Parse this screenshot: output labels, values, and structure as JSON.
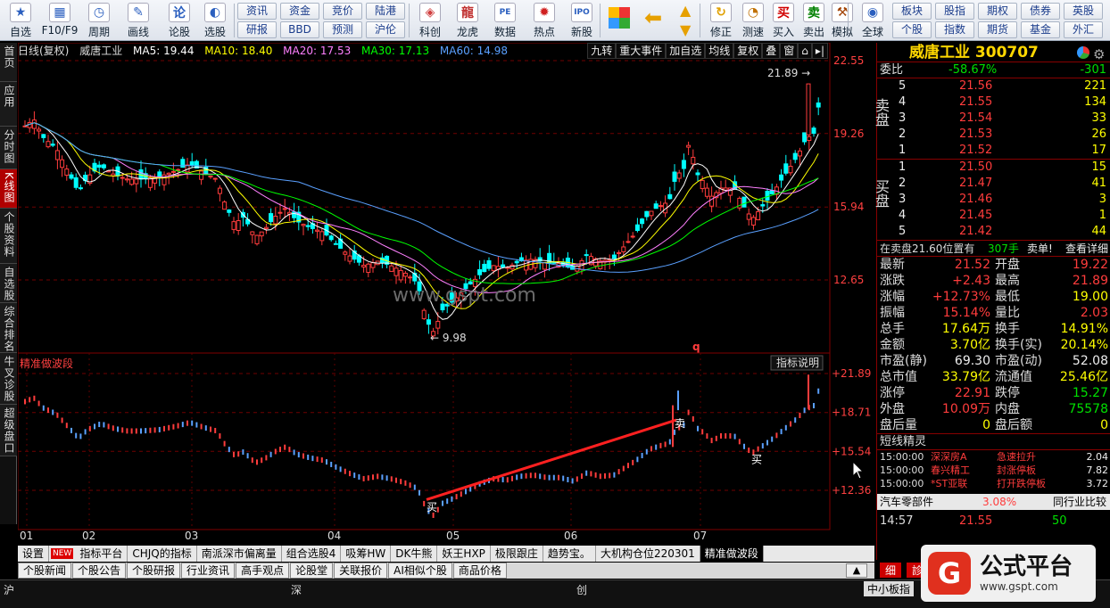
{
  "toolbar": {
    "buttons": [
      {
        "label": "自选",
        "icon": "star-icon"
      },
      {
        "label": "F10/F9",
        "icon": "f10-icon"
      },
      {
        "label": "周期",
        "icon": "clock-icon"
      },
      {
        "label": "画线",
        "icon": "pen-icon"
      },
      {
        "label": "论股",
        "icon": "forum-icon"
      },
      {
        "label": "选股",
        "icon": "chart-select-icon"
      },
      {
        "label": "科创",
        "icon": "kechuang-icon"
      },
      {
        "label": "龙虎",
        "icon": "dragon-icon"
      },
      {
        "label": "数据",
        "icon": "pe-icon"
      },
      {
        "label": "热点",
        "icon": "hot-icon"
      },
      {
        "label": "新股",
        "icon": "ipo-icon"
      },
      {
        "label": "修正",
        "icon": "fix-icon"
      },
      {
        "label": "测速",
        "icon": "speed-icon"
      },
      {
        "label": "买入",
        "icon": "buy-icon"
      },
      {
        "label": "卖出",
        "icon": "sell-icon"
      },
      {
        "label": "模拟",
        "icon": "simulate-icon"
      },
      {
        "label": "全球",
        "icon": "globe-icon"
      }
    ],
    "small_buttons_row1": [
      "资讯",
      "资金",
      "竞价",
      "陆港"
    ],
    "small_buttons_row2": [
      "研报",
      "BBD",
      "预测",
      "沪伦"
    ],
    "small_buttons_right_row1": [
      "板块",
      "股指",
      "期权",
      "债券",
      "英股"
    ],
    "small_buttons_right_row2": [
      "个股",
      "指数",
      "期货",
      "基金",
      "外汇"
    ]
  },
  "left_tabs": [
    "首页",
    "应用",
    "分时图",
    "K线图",
    "个股资料",
    "自选股",
    "综合排名",
    "牛叉诊股",
    "超级盘口"
  ],
  "chart": {
    "period_label": "日线(复权)",
    "stock_name": "威唐工业",
    "ma5": "MA5: 19.44",
    "ma10": "MA10: 18.40",
    "ma20": "MA20: 17.53",
    "ma30": "MA30: 17.13",
    "ma60": "MA60: 14.98",
    "tools": [
      "九转",
      "重大事件",
      "加自选",
      "均线",
      "复权",
      "叠",
      "窗",
      "⌂",
      "▸|"
    ],
    "price_ticks": [
      "22.55",
      "19.26",
      "15.94",
      "12.65"
    ],
    "high_label": "21.89",
    "low_label": "9.98",
    "watermark": "www.gspt.com",
    "marker_q": "q",
    "indicator_name": "精准做波段",
    "indicator_help": "指标说明",
    "indicator_ticks": [
      "+21.89",
      "+18.71",
      "+15.54",
      "+12.36"
    ],
    "sell_label": "卖",
    "buy_label": "买",
    "buy_label2": "买",
    "months": [
      "01",
      "02",
      "03",
      "04",
      "05",
      "06",
      "07"
    ]
  },
  "chart_colors": {
    "up": "#ff3c3c",
    "down": "#00ffff",
    "ma5": "#ffffff",
    "ma10": "#ffff00",
    "ma20": "#ff80ff",
    "ma30": "#00ff00",
    "ma60": "#5aa0ff"
  },
  "bottom_tabs": [
    "设置",
    "NEW",
    "指标平台",
    "CHJQ的指标",
    "南派深市偏离量",
    "组合选股4",
    "吸筹HW",
    "DK牛熊",
    "妖王HXP",
    "极限跟庄",
    "趋势宝。",
    "大机构仓位220301",
    "精准做波段"
  ],
  "info_tabs": [
    "个股新闻",
    "个股公告",
    "个股研报",
    "行业资讯",
    "高手观点",
    "论股堂",
    "关联报价",
    "AI相似个股",
    "商品价格"
  ],
  "status": {
    "sh": "沪",
    "sz": "深",
    "cy": "创",
    "zxb": "中小板指"
  },
  "right": {
    "title": "威唐工业 300707",
    "weibi_label": "委比",
    "weibi_val": "-58.67%",
    "weicha_val": "-301",
    "sell_side": "卖盘",
    "buy_side": "买盘",
    "asks": [
      {
        "n": "5",
        "p": "21.56",
        "v": "221"
      },
      {
        "n": "4",
        "p": "21.55",
        "v": "134"
      },
      {
        "n": "3",
        "p": "21.54",
        "v": "33"
      },
      {
        "n": "2",
        "p": "21.53",
        "v": "26"
      },
      {
        "n": "1",
        "p": "21.52",
        "v": "17"
      }
    ],
    "bids": [
      {
        "n": "1",
        "p": "21.50",
        "v": "15"
      },
      {
        "n": "2",
        "p": "21.47",
        "v": "41"
      },
      {
        "n": "3",
        "p": "21.46",
        "v": "3"
      },
      {
        "n": "4",
        "p": "21.45",
        "v": "1"
      },
      {
        "n": "5",
        "p": "21.42",
        "v": "44"
      }
    ],
    "notice_left": "在卖盘21.60位置有",
    "notice_vol": "307手",
    "notice_type": "卖单!",
    "notice_link": "查看详细",
    "quote_rows": [
      {
        "k1": "最新",
        "v1": "21.52",
        "c1": "red",
        "k2": "开盘",
        "v2": "19.22",
        "c2": "red"
      },
      {
        "k1": "涨跌",
        "v1": "+2.43",
        "c1": "red",
        "k2": "最高",
        "v2": "21.89",
        "c2": "red"
      },
      {
        "k1": "涨幅",
        "v1": "+12.73%",
        "c1": "red",
        "k2": "最低",
        "v2": "19.00",
        "c2": "yellow"
      },
      {
        "k1": "振幅",
        "v1": "15.14%",
        "c1": "red",
        "k2": "量比",
        "v2": "2.03",
        "c2": "red"
      },
      {
        "k1": "总手",
        "v1": "17.64万",
        "c1": "yellow",
        "k2": "换手",
        "v2": "14.91%",
        "c2": "yellow"
      },
      {
        "k1": "金额",
        "v1": "3.70亿",
        "c1": "yellow",
        "k2": "换手(实)",
        "v2": "20.14%",
        "c2": "yellow"
      },
      {
        "k1": "市盈(静)",
        "v1": "69.30",
        "c1": "white",
        "k2": "市盈(动)",
        "v2": "52.08",
        "c2": "white"
      },
      {
        "k1": "总市值",
        "v1": "33.79亿",
        "c1": "yellow",
        "k2": "流通值",
        "v2": "25.46亿",
        "c2": "yellow"
      },
      {
        "k1": "涨停",
        "v1": "22.91",
        "c1": "red",
        "k2": "跌停",
        "v2": "15.27",
        "c2": "green"
      },
      {
        "k1": "外盘",
        "v1": "10.09万",
        "c1": "red",
        "k2": "内盘",
        "v2": "75578",
        "c2": "green"
      },
      {
        "k1": "盘后量",
        "v1": "0",
        "c1": "yellow",
        "k2": "盘后额",
        "v2": "0",
        "c2": "yellow"
      }
    ],
    "sprite_title": "短线精灵",
    "sprites": [
      {
        "t": "15:00:00",
        "name": "深深房A",
        "ev": "急速拉升",
        "val": "2.04"
      },
      {
        "t": "15:00:00",
        "name": "春兴精工",
        "ev": "封涨停板",
        "val": "7.82"
      },
      {
        "t": "15:00:00",
        "name": "*ST亚联",
        "ev": "打开跌停板",
        "val": "3.72"
      }
    ],
    "sector_name": "汽车零部件",
    "sector_pct": "3.08%",
    "sector_link": "同行业比较",
    "tick_time": "14:57",
    "tick_price": "21.55",
    "tick_vol": "50",
    "tab_detail": "细",
    "tab_detail2": "診"
  },
  "brand": {
    "name": "公式平台",
    "url": "www.gspt.com"
  }
}
